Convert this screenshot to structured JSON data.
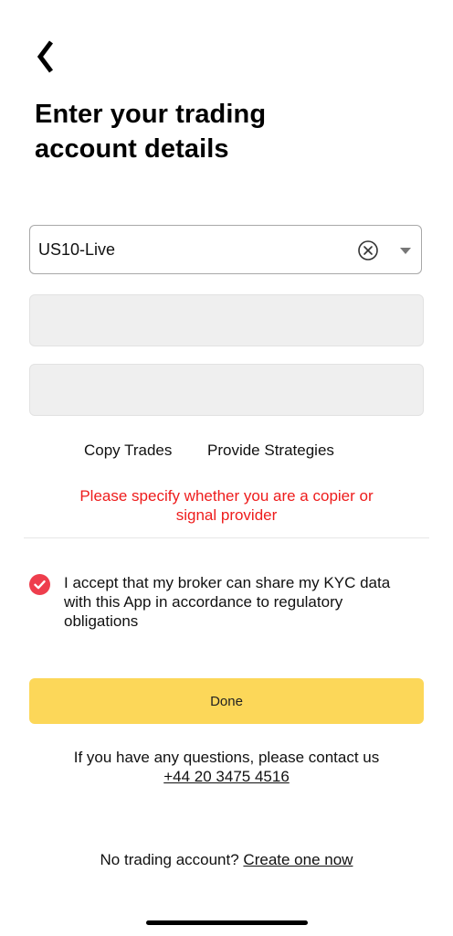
{
  "header": {
    "back_icon": "chevron-left-icon",
    "title_line1": "Enter your trading",
    "title_line2": "account details"
  },
  "server_select": {
    "value": "US10-Live",
    "clear_icon": "circle-x-icon",
    "dropdown_icon": "caret-down-icon"
  },
  "fields": {
    "field1_value": "",
    "field2_value": ""
  },
  "role_options": {
    "copy_label": "Copy Trades",
    "provide_label": "Provide Strategies"
  },
  "error": {
    "line1": "Please specify whether you are a copier or",
    "line2": "signal provider",
    "color": "#ee1c1c"
  },
  "consent": {
    "checked": true,
    "check_color": "#ee3e4d",
    "line1": "I accept that my broker can share my KYC data",
    "line2": "with this App in accordance to regulatory",
    "line3": "obligations"
  },
  "done_button": {
    "label": "Done",
    "color": "#fcd759"
  },
  "contact": {
    "text": "If you have any questions, please contact us",
    "phone": "+44 20 3475 4516"
  },
  "footer": {
    "prompt": "No trading account?",
    "link": "Create one now"
  }
}
